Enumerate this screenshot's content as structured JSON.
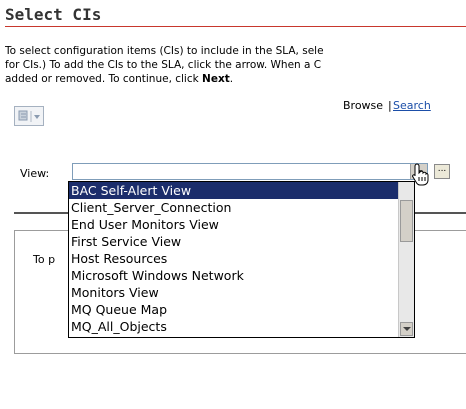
{
  "page": {
    "title": "Select CIs",
    "instructions": {
      "line1": "To select configuration items (CIs) to include in the SLA, sele",
      "line2": "for CIs.) To add the CIs to the SLA, click the arrow. When a C",
      "line3_prefix": "added or removed. To continue, click ",
      "line3_bold": "Next",
      "line3_suffix": "."
    }
  },
  "toolbar": {
    "icon": "view-menu-icon",
    "browse_label": "Browse",
    "separator": "|",
    "search_label": "Search"
  },
  "view": {
    "label": "View:",
    "selected_value": "",
    "more_button_label": "...",
    "options": [
      "BAC Self-Alert View",
      "Client_Server_Connection",
      "End User Monitors View",
      "First Service View",
      "Host Resources",
      "Microsoft Windows Network",
      "Monitors View",
      "MQ Queue Map",
      "MQ_All_Objects"
    ],
    "highlighted_option": "BAC Self-Alert View"
  },
  "content": {
    "text": "To p"
  },
  "colors": {
    "title_rule": "#c8372d",
    "selection_bg": "#1b2d6b",
    "link": "#1b4ea8"
  },
  "cursor": "hand-pointer-icon"
}
